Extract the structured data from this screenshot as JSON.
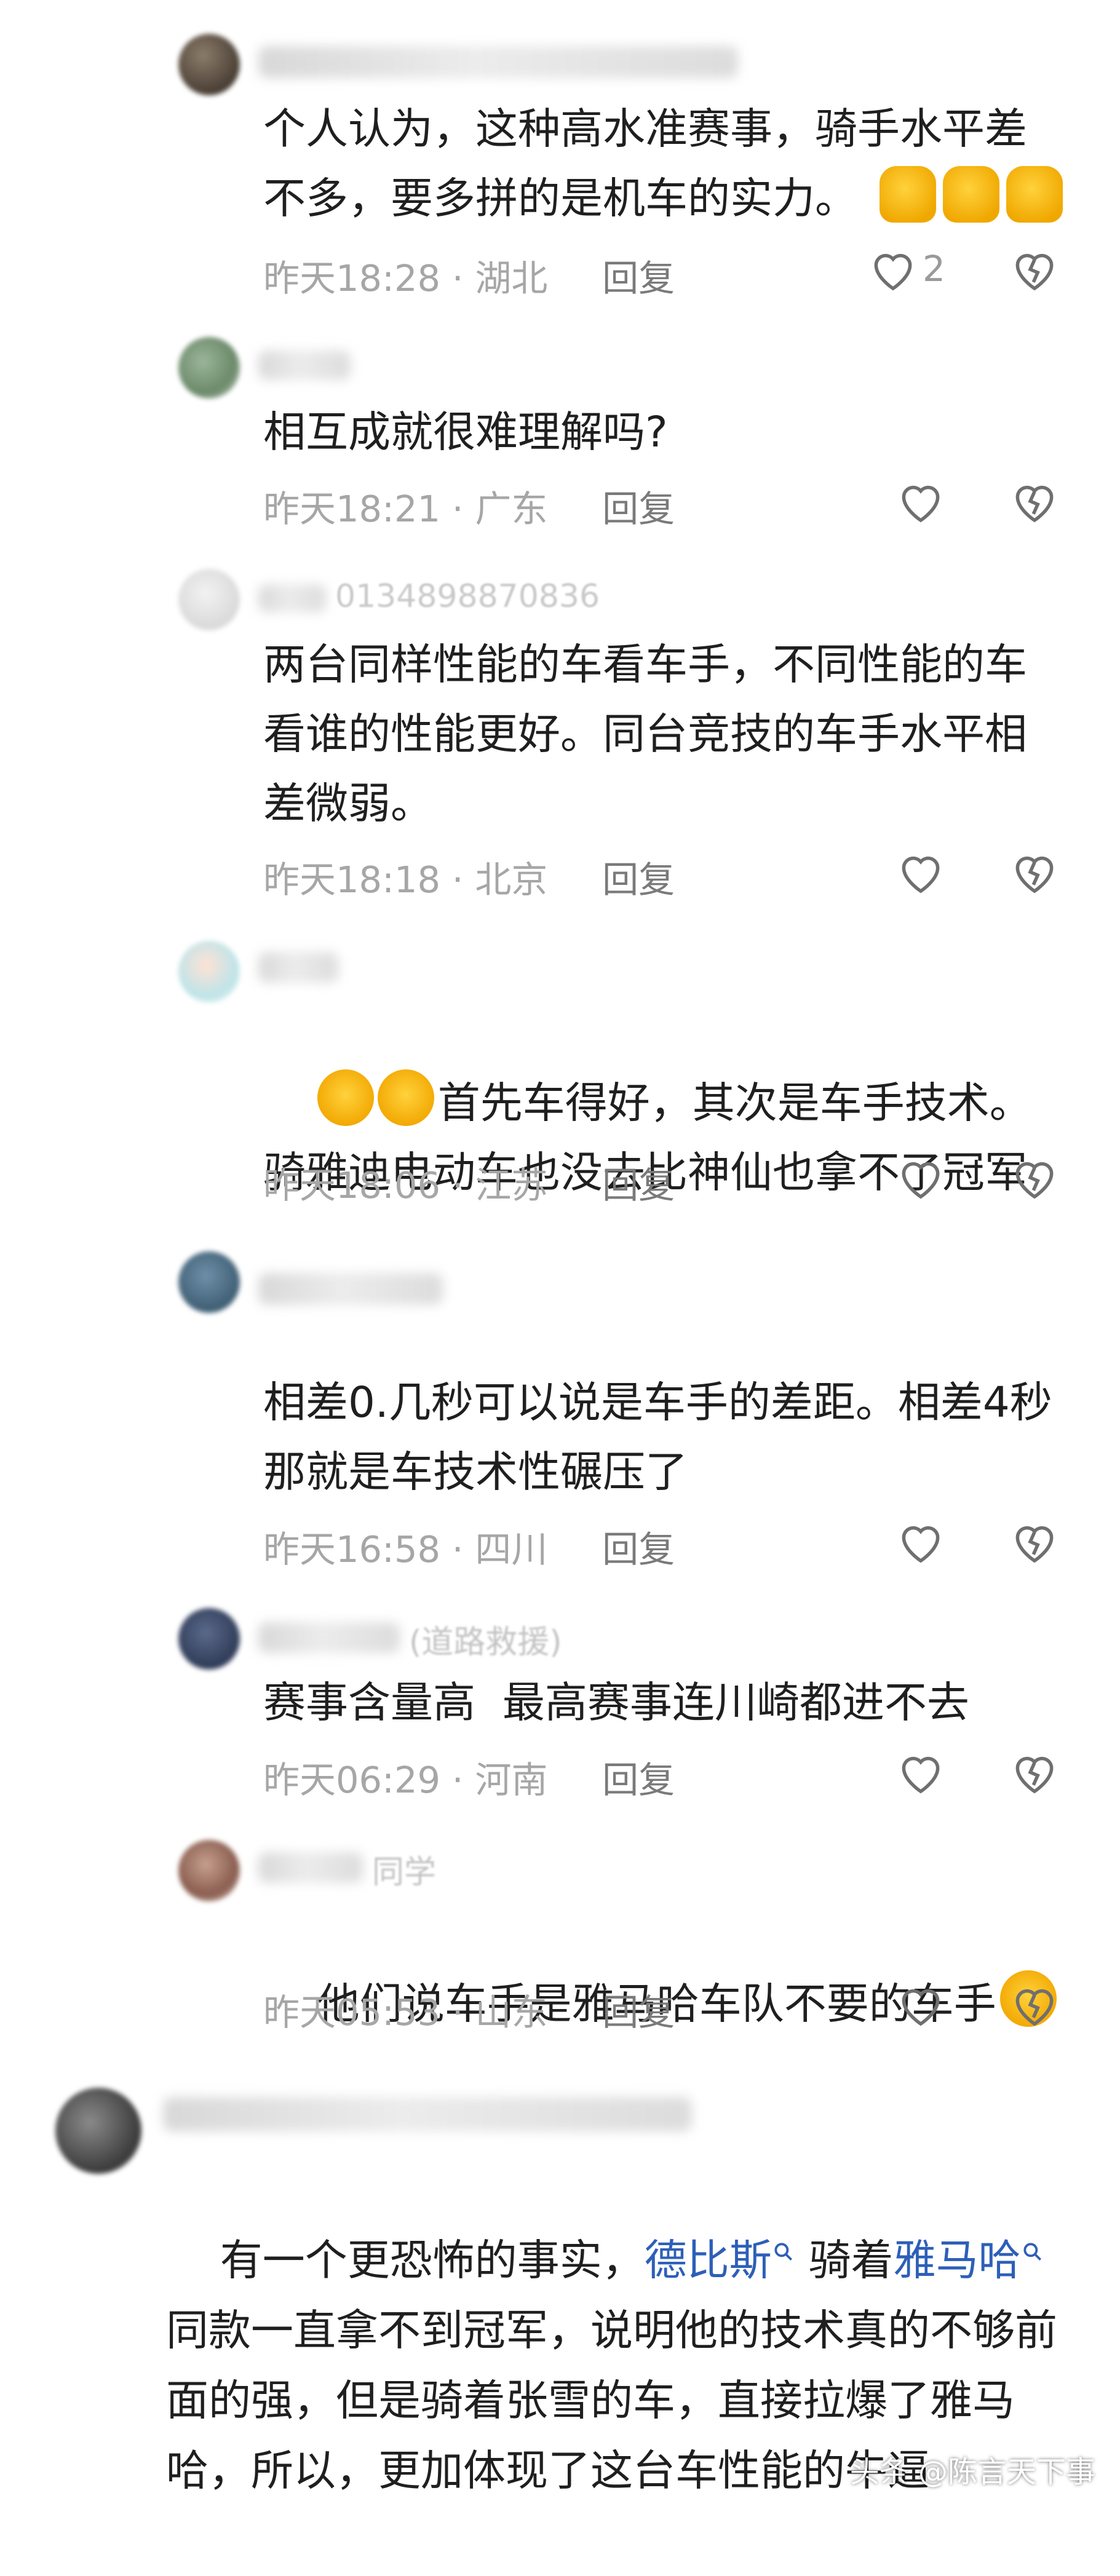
{
  "comments": [
    {
      "text": "个人认为，这种高水准赛事，骑手水平差不多，要多拼的是机车的实力。",
      "time": "昨天18:28",
      "location": "湖北",
      "like_count": "2"
    },
    {
      "text": "相互成就很难理解吗?",
      "time": "昨天18:21",
      "location": "广东"
    },
    {
      "username_visible": "0134898870836",
      "text": "两台同样性能的车看车手，不同性能的车看谁的性能更好。同台竞技的车手水平相差微弱。",
      "time": "昨天18:18",
      "location": "北京"
    },
    {
      "text": "首先车得好，其次是车手技术。骑雅迪电动车也没去比神仙也拿不了冠军",
      "time": "昨天18:06",
      "location": "江苏"
    },
    {
      "text": "相差0.几秒可以说是车手的差距。相差4秒那就是车技术性碾压了",
      "time": "昨天16:58",
      "location": "四川"
    },
    {
      "username_visible": "(道路救援)",
      "text": "赛事含量高  最高赛事连川崎都进不去",
      "time": "昨天06:29",
      "location": "河南"
    },
    {
      "username_visible": "同学",
      "text": "他们说车手是雅马哈车队不要的车手",
      "time": "昨天05:53",
      "location": "山东"
    }
  ],
  "main_comment": {
    "text_before_link1": "有一个更恐怖的事实，",
    "link1": "德比斯",
    "text_mid": " 骑着",
    "link2": "雅马哈",
    "text_after": " 同款一直拿不到冠军，说明他的技术真的不够前面的强，但是骑着张雪的车，直接拉爆了雅马哈，所以，更加体现了这台车性能的牛逼"
  },
  "labels": {
    "reply": "回复",
    "separator": "·"
  },
  "watermark": "头条 @陈言天下事",
  "colors": {
    "text": "#1f1f1f",
    "meta": "#a6a6a6",
    "link": "#2d5fb8"
  }
}
